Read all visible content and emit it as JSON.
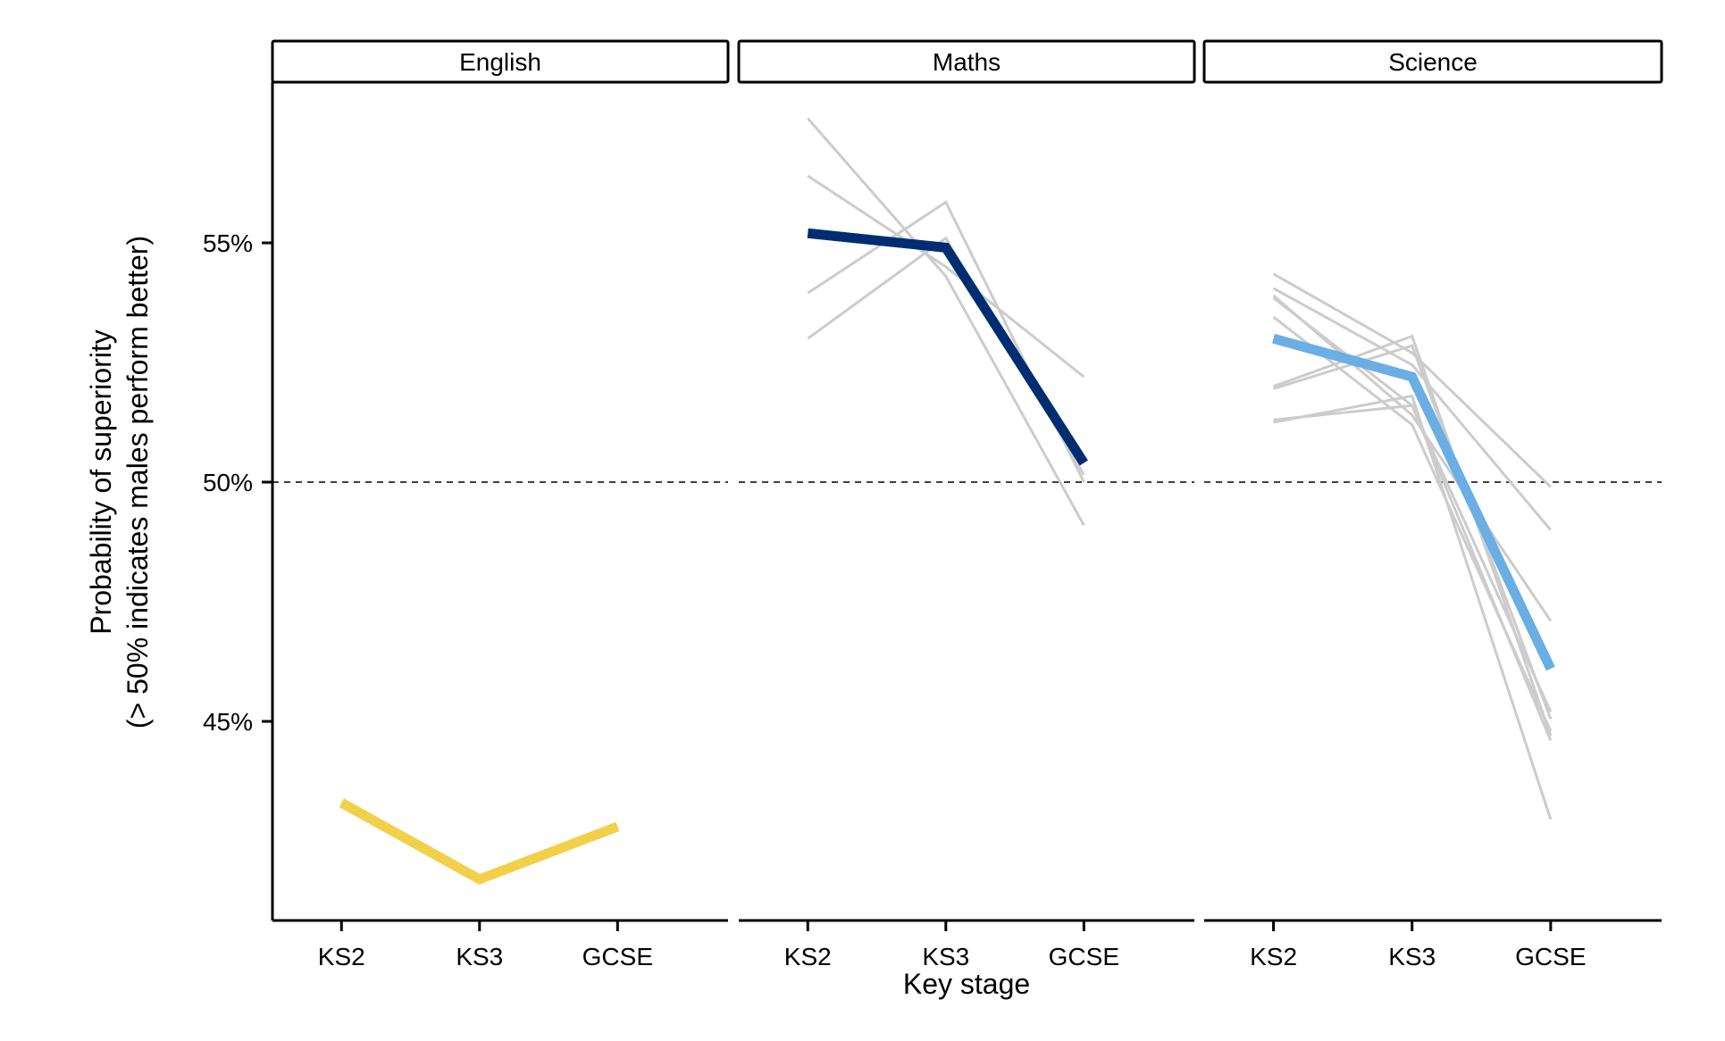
{
  "chart_data": {
    "type": "line",
    "facet_by": "subject",
    "xlabel": "Key stage",
    "ylabel_lines": [
      "Probability of superiority",
      "(> 50% indicates males perform better)"
    ],
    "categories": [
      "KS2",
      "KS3",
      "GCSE"
    ],
    "ylim": [
      40.9,
      58.4
    ],
    "yticks": [
      45,
      50,
      55
    ],
    "ytick_labels": [
      "45%",
      "50%",
      "55%"
    ],
    "reference_line": {
      "y": 50,
      "style": "dashed"
    },
    "grid": false,
    "legend": "none",
    "panels": [
      {
        "title": "English",
        "main": {
          "color": "#F2D04A",
          "values": [
            43.3,
            41.7,
            42.8
          ]
        },
        "background_color": "#CCCCCC",
        "background_series": []
      },
      {
        "title": "Maths",
        "main": {
          "color": "#002D72",
          "values": [
            55.2,
            54.9,
            50.4
          ]
        },
        "background_color": "#CCCCCC",
        "background_series": [
          [
            57.6,
            54.3,
            49.1
          ],
          [
            56.4,
            54.5,
            52.2
          ],
          [
            53.95,
            55.85,
            50.0
          ],
          [
            53.0,
            55.1,
            50.15
          ]
        ]
      },
      {
        "title": "Science",
        "main": {
          "color": "#6AAEE3",
          "values": [
            53.0,
            52.2,
            46.1
          ]
        },
        "background_color": "#CCCCCC",
        "background_series": [
          [
            54.35,
            52.7,
            49.9
          ],
          [
            54.05,
            52.45,
            49.0
          ],
          [
            53.9,
            51.4,
            47.1
          ],
          [
            53.85,
            51.6,
            45.2
          ],
          [
            53.45,
            51.2,
            44.8
          ],
          [
            52.0,
            53.05,
            44.7
          ],
          [
            51.95,
            52.85,
            45.05
          ],
          [
            51.25,
            51.8,
            42.95
          ],
          [
            51.3,
            51.6,
            44.6
          ]
        ]
      }
    ]
  }
}
